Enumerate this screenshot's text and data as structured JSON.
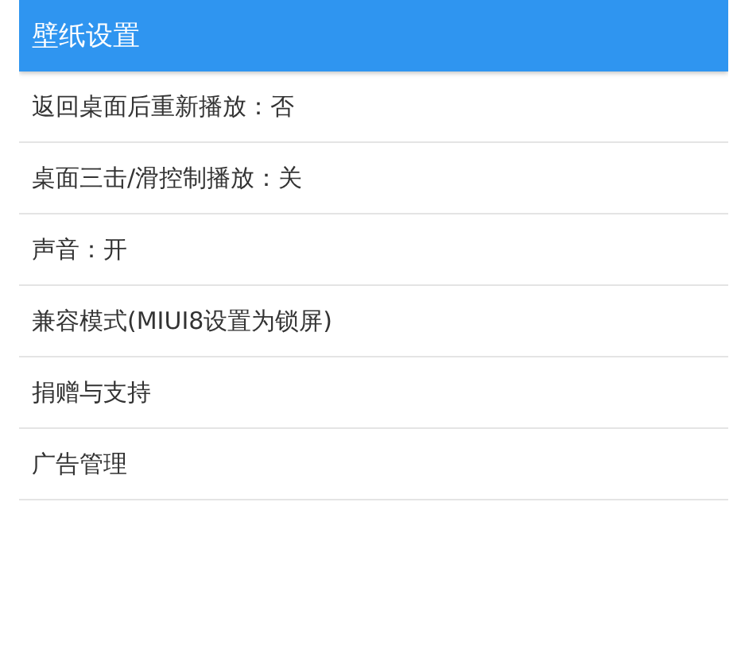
{
  "toolbar": {
    "title": "壁纸设置"
  },
  "settings": [
    {
      "label": "返回桌面后重新播放：否"
    },
    {
      "label": "桌面三击/滑控制播放：关"
    },
    {
      "label": "声音：开"
    },
    {
      "label": "兼容模式(MIUI8设置为锁屏)"
    },
    {
      "label": "捐赠与支持"
    },
    {
      "label": "广告管理"
    }
  ]
}
